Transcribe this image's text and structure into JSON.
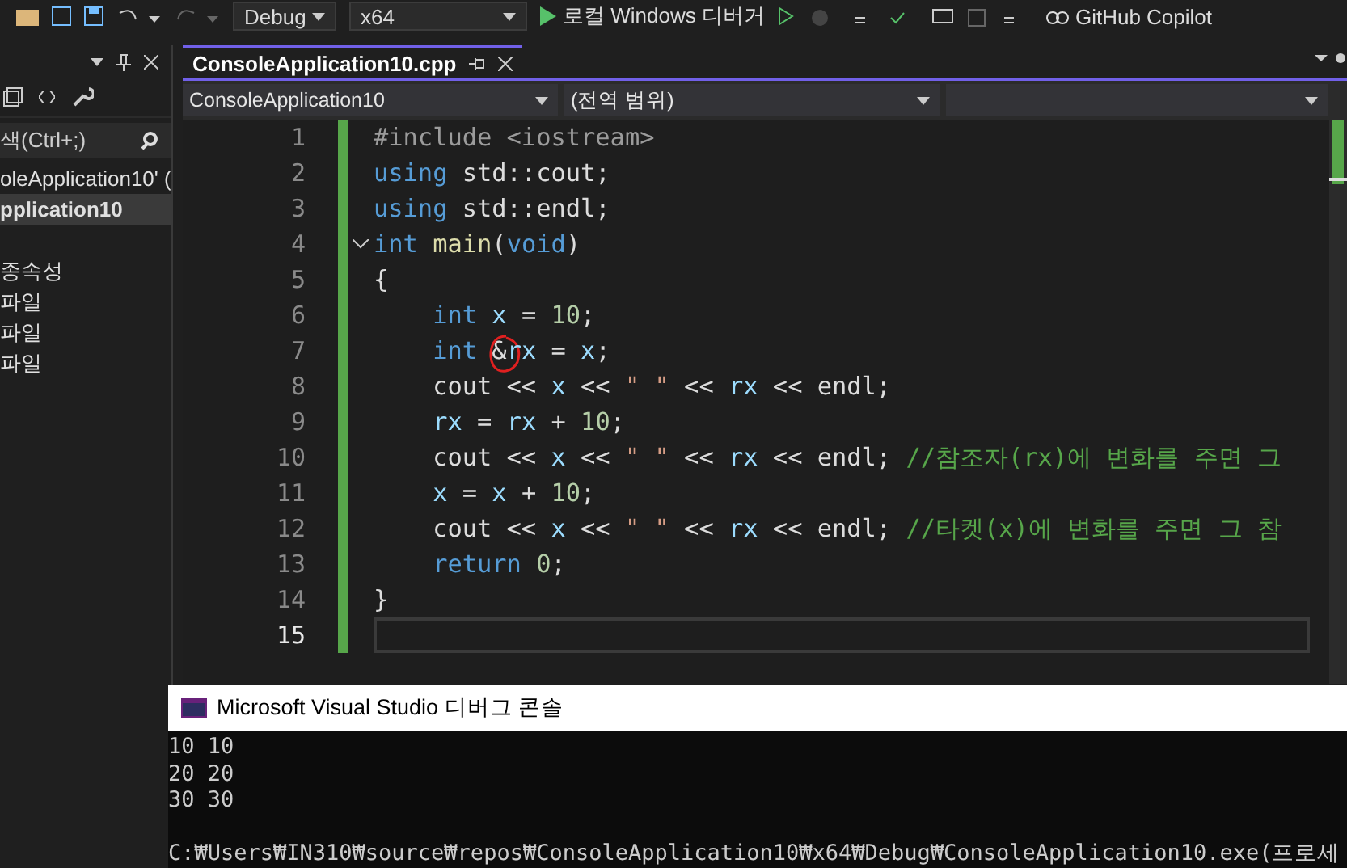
{
  "toolbar": {
    "configuration": "Debug",
    "platform": "x64",
    "debugger": "로컬 Windows 디버거",
    "copilot": "GitHub Copilot"
  },
  "solution_explorer": {
    "search": {
      "placeholder": "색(Ctrl+;)"
    },
    "items": [
      {
        "label": "oleApplication10'  (",
        "kind": "solution",
        "selected": false
      },
      {
        "label": "pplication10",
        "kind": "project",
        "selected": true
      },
      {
        "label": "종속성",
        "kind": "folder",
        "selected": false
      },
      {
        "label": "파일",
        "kind": "folder",
        "selected": false
      },
      {
        "label": "파일",
        "kind": "folder",
        "selected": false
      },
      {
        "label": "파일",
        "kind": "folder",
        "selected": false
      }
    ]
  },
  "editor": {
    "tab": {
      "label": "ConsoleApplication10.cpp",
      "selected": true
    },
    "nav": {
      "project": "ConsoleApplication10",
      "scope": "(전역 범위)"
    },
    "lines": [
      {
        "number": "1",
        "current": false,
        "tokens": [
          {
            "kind": "pre",
            "text": "#include <iostream>"
          }
        ]
      },
      {
        "number": "2",
        "current": false,
        "tokens": [
          {
            "kind": "kw",
            "text": "using"
          },
          {
            "kind": "plain",
            "text": " std::cout;"
          }
        ]
      },
      {
        "number": "3",
        "current": false,
        "tokens": [
          {
            "kind": "kw",
            "text": "using"
          },
          {
            "kind": "plain",
            "text": " std::endl;"
          }
        ]
      },
      {
        "number": "4",
        "current": false,
        "expanded": true,
        "tokens": [
          {
            "kind": "kw",
            "text": "int"
          },
          {
            "kind": "fn",
            "text": " main"
          },
          {
            "kind": "plain",
            "text": "("
          },
          {
            "kind": "kw",
            "text": "void"
          },
          {
            "kind": "plain",
            "text": ")"
          }
        ]
      },
      {
        "number": "5",
        "current": false,
        "tokens": [
          {
            "kind": "plain",
            "text": "{"
          }
        ]
      },
      {
        "number": "6",
        "current": false,
        "tokens": [
          {
            "kind": "kw",
            "text": "    int"
          },
          {
            "kind": "var",
            "text": " x"
          },
          {
            "kind": "plain",
            "text": " = "
          },
          {
            "kind": "num",
            "text": "10"
          },
          {
            "kind": "plain",
            "text": ";"
          }
        ]
      },
      {
        "number": "7",
        "current": false,
        "tokens": [
          {
            "kind": "kw",
            "text": "    int"
          },
          {
            "kind": "plain",
            "text": " &",
            "circled": true
          },
          {
            "kind": "var",
            "text": "rx"
          },
          {
            "kind": "plain",
            "text": " = "
          },
          {
            "kind": "var",
            "text": "x"
          },
          {
            "kind": "plain",
            "text": ";"
          }
        ]
      },
      {
        "number": "8",
        "current": false,
        "tokens": [
          {
            "kind": "plain",
            "text": "    cout << "
          },
          {
            "kind": "var",
            "text": "x"
          },
          {
            "kind": "plain",
            "text": " << "
          },
          {
            "kind": "str",
            "text": "\" \""
          },
          {
            "kind": "plain",
            "text": " << "
          },
          {
            "kind": "var",
            "text": "rx"
          },
          {
            "kind": "plain",
            "text": " << endl;"
          }
        ]
      },
      {
        "number": "9",
        "current": false,
        "tokens": [
          {
            "kind": "var",
            "text": "    rx"
          },
          {
            "kind": "plain",
            "text": " = "
          },
          {
            "kind": "var",
            "text": "rx"
          },
          {
            "kind": "plain",
            "text": " + "
          },
          {
            "kind": "num",
            "text": "10"
          },
          {
            "kind": "plain",
            "text": ";"
          }
        ]
      },
      {
        "number": "10",
        "current": false,
        "tokens": [
          {
            "kind": "plain",
            "text": "    cout << "
          },
          {
            "kind": "var",
            "text": "x"
          },
          {
            "kind": "plain",
            "text": " << "
          },
          {
            "kind": "str",
            "text": "\" \""
          },
          {
            "kind": "plain",
            "text": " << "
          },
          {
            "kind": "var",
            "text": "rx"
          },
          {
            "kind": "plain",
            "text": " << endl; "
          },
          {
            "kind": "com",
            "text": "//참조자(rx)에 변화를 주면 그"
          }
        ]
      },
      {
        "number": "11",
        "current": false,
        "tokens": [
          {
            "kind": "var",
            "text": "    x"
          },
          {
            "kind": "plain",
            "text": " = "
          },
          {
            "kind": "var",
            "text": "x"
          },
          {
            "kind": "plain",
            "text": " + "
          },
          {
            "kind": "num",
            "text": "10"
          },
          {
            "kind": "plain",
            "text": ";"
          }
        ]
      },
      {
        "number": "12",
        "current": false,
        "tokens": [
          {
            "kind": "plain",
            "text": "    cout << "
          },
          {
            "kind": "var",
            "text": "x"
          },
          {
            "kind": "plain",
            "text": " << "
          },
          {
            "kind": "str",
            "text": "\" \""
          },
          {
            "kind": "plain",
            "text": " << "
          },
          {
            "kind": "var",
            "text": "rx"
          },
          {
            "kind": "plain",
            "text": " << endl; "
          },
          {
            "kind": "com",
            "text": "//타켓(x)에 변화를 주면 그 참"
          }
        ]
      },
      {
        "number": "13",
        "current": false,
        "tokens": [
          {
            "kind": "kw",
            "text": "    return"
          },
          {
            "kind": "num",
            "text": " 0"
          },
          {
            "kind": "plain",
            "text": ";"
          }
        ]
      },
      {
        "number": "14",
        "current": false,
        "tokens": [
          {
            "kind": "plain",
            "text": "}"
          }
        ]
      },
      {
        "number": "15",
        "current": true
      }
    ]
  },
  "console": {
    "title": "Microsoft Visual Studio 디버그 콘솔",
    "output": [
      "10 10",
      "20 20",
      "30 30"
    ],
    "path_line": "C:₩Users₩IN310₩source₩repos₩ConsoleApplication10₩x64₩Debug₩ConsoleApplication10.exe(프로세"
  }
}
